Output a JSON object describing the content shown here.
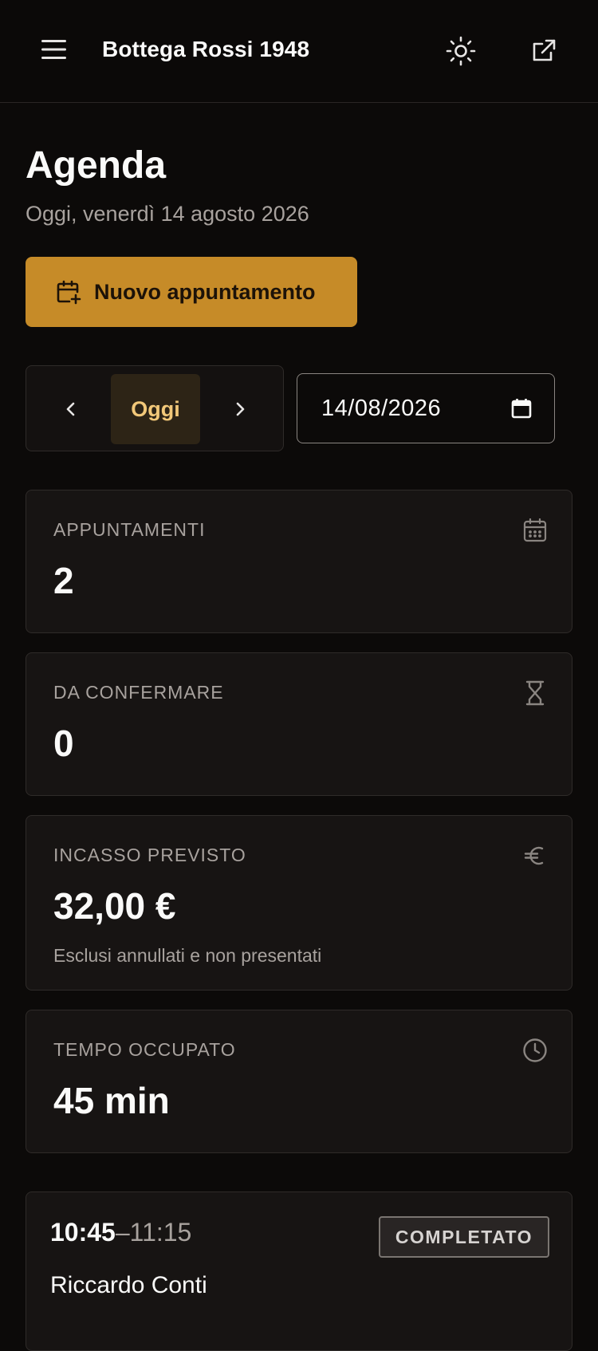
{
  "header": {
    "brand": "Bottega Rossi 1948"
  },
  "page": {
    "title": "Agenda",
    "subtitle": "Oggi, venerdì 14 agosto 2026"
  },
  "actions": {
    "new_appointment": "Nuovo appuntamento"
  },
  "day_nav": {
    "today_label": "Oggi",
    "date_value": "14/08/2026"
  },
  "stats": [
    {
      "label": "APPUNTAMENTI",
      "value": "2",
      "icon": "calendar-icon"
    },
    {
      "label": "DA CONFERMARE",
      "value": "0",
      "icon": "hourglass-icon"
    },
    {
      "label": "INCASSO PREVISTO",
      "value": "32,00 €",
      "note": "Esclusi annullati e non presentati",
      "icon": "euro-icon"
    },
    {
      "label": "TEMPO OCCUPATO",
      "value": "45 min",
      "icon": "clock-icon"
    }
  ],
  "appointments": [
    {
      "start": "10:45",
      "sep": "–",
      "end": "11:15",
      "status": "COMPLETATO",
      "client": "Riccardo Conti"
    }
  ],
  "colors": {
    "background": "#0c0a09",
    "accent": "#c68b28",
    "card": "#171413"
  }
}
